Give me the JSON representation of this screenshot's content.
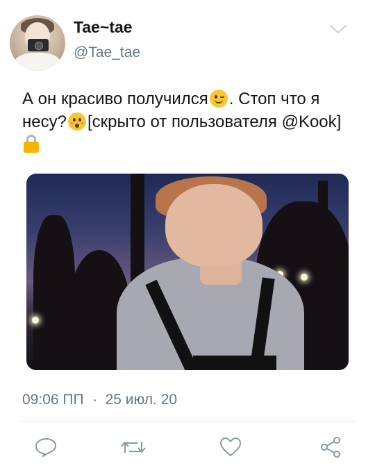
{
  "author": {
    "display_name": "Tae~tae",
    "handle": "@Tae_tae"
  },
  "tweet": {
    "text_part1": "А он красиво получился",
    "text_part2": ". Стоп что я несу?",
    "text_part3": "[скрыто от пользователя @Kook]"
  },
  "meta": {
    "time": "09:06 ПП",
    "date": "25 июл. 20"
  },
  "icons": {
    "menu": "chevron-down-icon",
    "reply": "reply-icon",
    "retweet": "retweet-icon",
    "like": "heart-icon",
    "share": "share-icon"
  },
  "colors": {
    "secondary_text": "#657786",
    "icon": "#8899a6"
  }
}
